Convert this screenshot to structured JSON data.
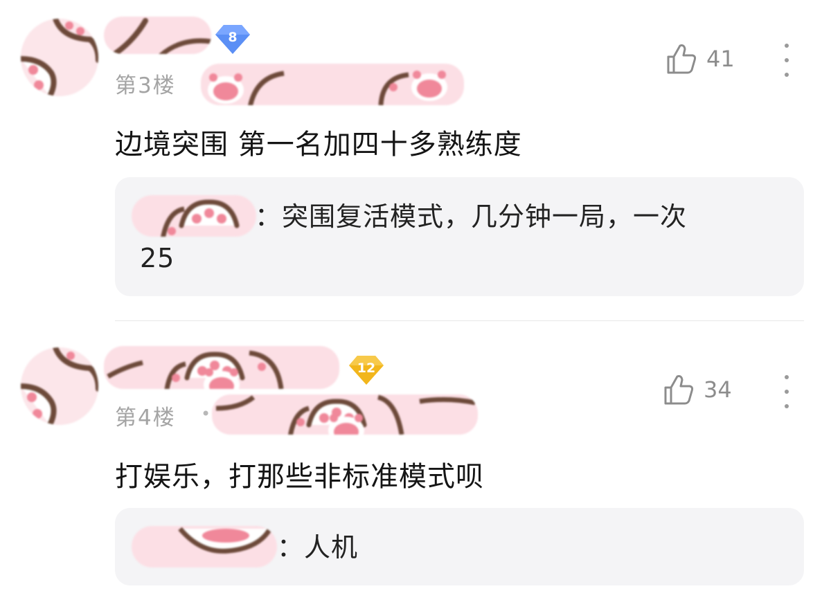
{
  "comments": [
    {
      "level": "8",
      "level_color": "#5b8ff5",
      "floor": "第3楼",
      "likes": "41",
      "content": "边境突围 第一名加四十多熟练度",
      "reply": {
        "text_line1": "：突围复活模式，几分钟一局，一次",
        "text_line2": "25"
      }
    },
    {
      "level": "12",
      "level_color": "#f2b61c",
      "floor": "第4楼",
      "floor_separator": "•",
      "likes": "34",
      "content": "打娱乐，打那些非标准模式呗",
      "reply": {
        "text_line1": "：人机"
      }
    }
  ],
  "icons": {
    "like": "thumbs-up-icon",
    "more": "vertical-ellipsis-icon",
    "level": "diamond-level-badge"
  },
  "colors": {
    "sticker_pink": "#fcdfe5",
    "paw_pad": "#f0889a",
    "paw_outline": "#6d4a3a",
    "reply_bg": "#f4f4f6"
  }
}
